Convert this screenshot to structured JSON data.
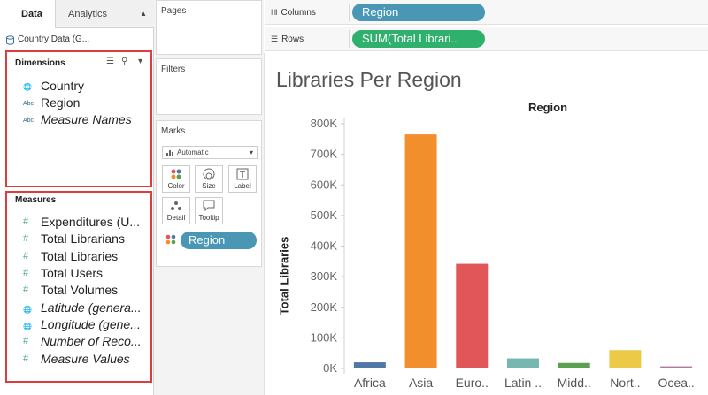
{
  "tabs": {
    "data": "Data",
    "analytics": "Analytics"
  },
  "datasource": "Country Data (G...",
  "dimensions": {
    "title": "Dimensions",
    "items": [
      {
        "icon": "globe-icon",
        "label": "Country",
        "italic": false
      },
      {
        "icon": "abc-icon",
        "label": "Region",
        "italic": false
      },
      {
        "icon": "abc-icon",
        "label": "Measure Names",
        "italic": true
      }
    ]
  },
  "measures": {
    "title": "Measures",
    "items": [
      {
        "icon": "hash-icon",
        "label": "Expenditures (U...",
        "italic": false
      },
      {
        "icon": "hash-icon",
        "label": "Total Librarians",
        "italic": false
      },
      {
        "icon": "hash-icon",
        "label": "Total Libraries",
        "italic": false
      },
      {
        "icon": "hash-icon",
        "label": "Total Users",
        "italic": false
      },
      {
        "icon": "hash-icon",
        "label": "Total Volumes",
        "italic": false
      },
      {
        "icon": "globe-icon",
        "label": "Latitude (genera...",
        "italic": true
      },
      {
        "icon": "globe-icon",
        "label": "Longitude (gene...",
        "italic": true
      },
      {
        "icon": "hash-icon",
        "label": "Number of Reco...",
        "italic": true
      },
      {
        "icon": "hash-icon",
        "label": "Measure Values",
        "italic": true
      }
    ]
  },
  "cards": {
    "pages": "Pages",
    "filters": "Filters",
    "marks": "Marks"
  },
  "marks": {
    "type": "Automatic",
    "buttons": {
      "color": "Color",
      "size": "Size",
      "label": "Label",
      "detail": "Detail",
      "tooltip": "Tooltip"
    },
    "color_pill": "Region"
  },
  "shelves": {
    "columns_label": "Columns",
    "rows_label": "Rows",
    "columns_pill": "Region",
    "rows_pill": "SUM(Total Librari.."
  },
  "colors": {
    "dimension_pill": "#4997b4",
    "measure_pill": "#2fb16d",
    "highlight_box": "#e03c3c"
  },
  "chart_data": {
    "type": "bar",
    "title": "Libraries Per Region",
    "column_header": "Region",
    "ylabel": "Total Libraries",
    "categories": [
      "Africa",
      "Asia",
      "Euro..",
      "Latin ..",
      "Midd..",
      "Nort..",
      "Ocea.."
    ],
    "values": [
      20000,
      765000,
      342000,
      33000,
      18000,
      60000,
      7000
    ],
    "colors": [
      "#4e79a7",
      "#f28e2b",
      "#e15759",
      "#76b7b2",
      "#59a14f",
      "#edc948",
      "#b07aa1"
    ],
    "ylim": [
      0,
      800000
    ],
    "ticks": [
      0,
      100000,
      200000,
      300000,
      400000,
      500000,
      600000,
      700000,
      800000
    ],
    "tick_labels": [
      "0K",
      "100K",
      "200K",
      "300K",
      "400K",
      "500K",
      "600K",
      "700K",
      "800K"
    ],
    "grid": false
  }
}
